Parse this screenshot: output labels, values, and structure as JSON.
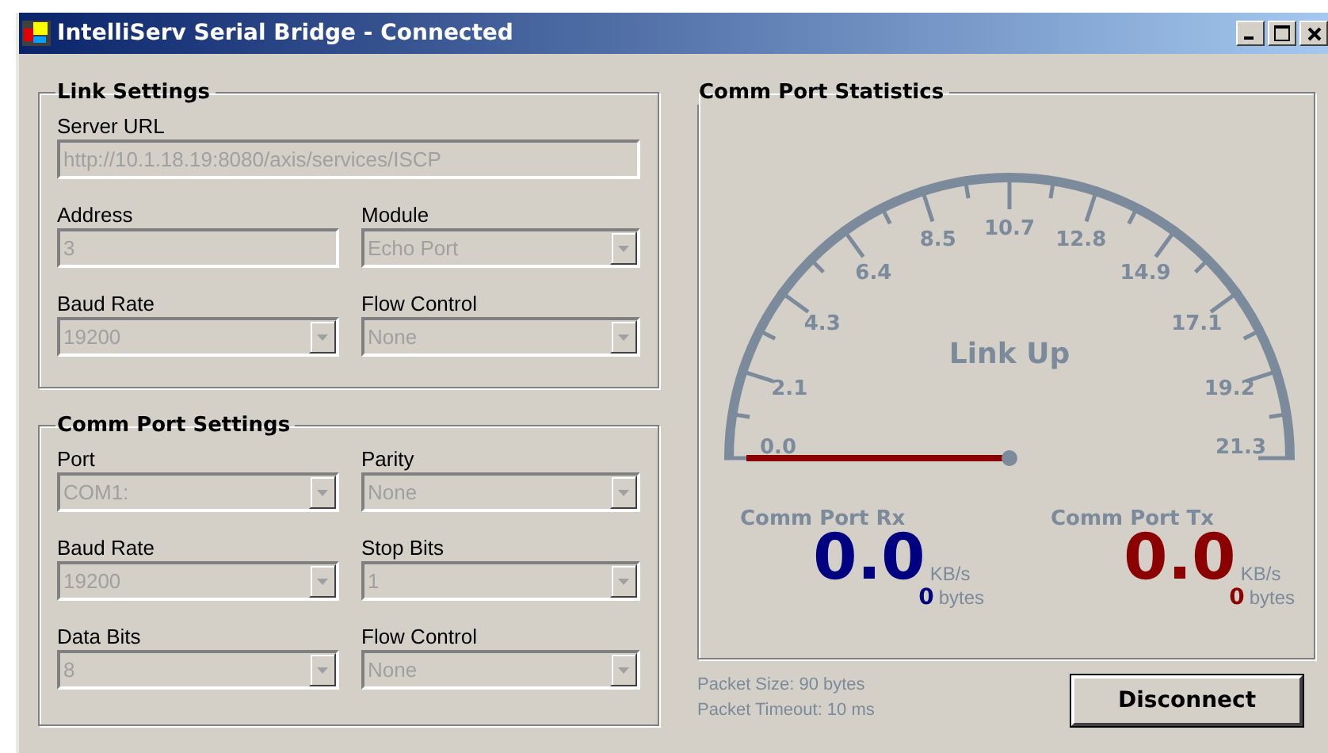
{
  "window": {
    "title": "IntelliServ Serial Bridge - Connected"
  },
  "link_settings": {
    "title": "Link Settings",
    "server_url": {
      "label": "Server URL",
      "value": "http://10.1.18.19:8080/axis/services/ISCP",
      "disabled": true
    },
    "fields": [
      {
        "label": "Address",
        "value": "3",
        "kind": "text",
        "disabled": true
      },
      {
        "label": "Module",
        "value": "Echo Port",
        "kind": "dropdown",
        "disabled": true
      },
      {
        "label": "Baud Rate",
        "value": "19200",
        "kind": "dropdown",
        "disabled": true
      },
      {
        "label": "Flow Control",
        "value": "None",
        "kind": "dropdown",
        "disabled": true
      }
    ]
  },
  "comm_port_settings": {
    "title": "Comm Port Settings",
    "fields": [
      {
        "label": "Port",
        "value": "COM1:",
        "kind": "dropdown",
        "disabled": true
      },
      {
        "label": "Parity",
        "value": "None",
        "kind": "dropdown",
        "disabled": true
      },
      {
        "label": "Baud Rate",
        "value": "19200",
        "kind": "dropdown",
        "disabled": true
      },
      {
        "label": "Stop Bits",
        "value": "1",
        "kind": "dropdown",
        "disabled": true
      },
      {
        "label": "Data Bits",
        "value": "8",
        "kind": "dropdown",
        "disabled": true
      },
      {
        "label": "Flow Control",
        "value": "None",
        "kind": "dropdown",
        "disabled": true
      }
    ]
  },
  "comm_port_statistics": {
    "title": "Comm Port Statistics",
    "gauge": {
      "status": "Link Up",
      "tick_labels": [
        "0.0",
        "2.1",
        "4.3",
        "6.4",
        "8.5",
        "10.7",
        "12.8",
        "14.9",
        "17.1",
        "19.2",
        "21.3"
      ]
    },
    "channels": [
      {
        "label": "Comm Port Rx",
        "rate": "0.0",
        "rate_unit": "KB/s",
        "count": "0",
        "count_unit": "bytes",
        "color": "#000080"
      },
      {
        "label": "Comm Port Tx",
        "rate": "0.0",
        "rate_unit": "KB/s",
        "count": "0",
        "count_unit": "bytes",
        "color": "#8b0000"
      }
    ]
  },
  "packet_info": [
    "Packet Size: 90 bytes",
    "Packet Timeout: 10 ms"
  ],
  "buttons": [
    "Disconnect"
  ]
}
